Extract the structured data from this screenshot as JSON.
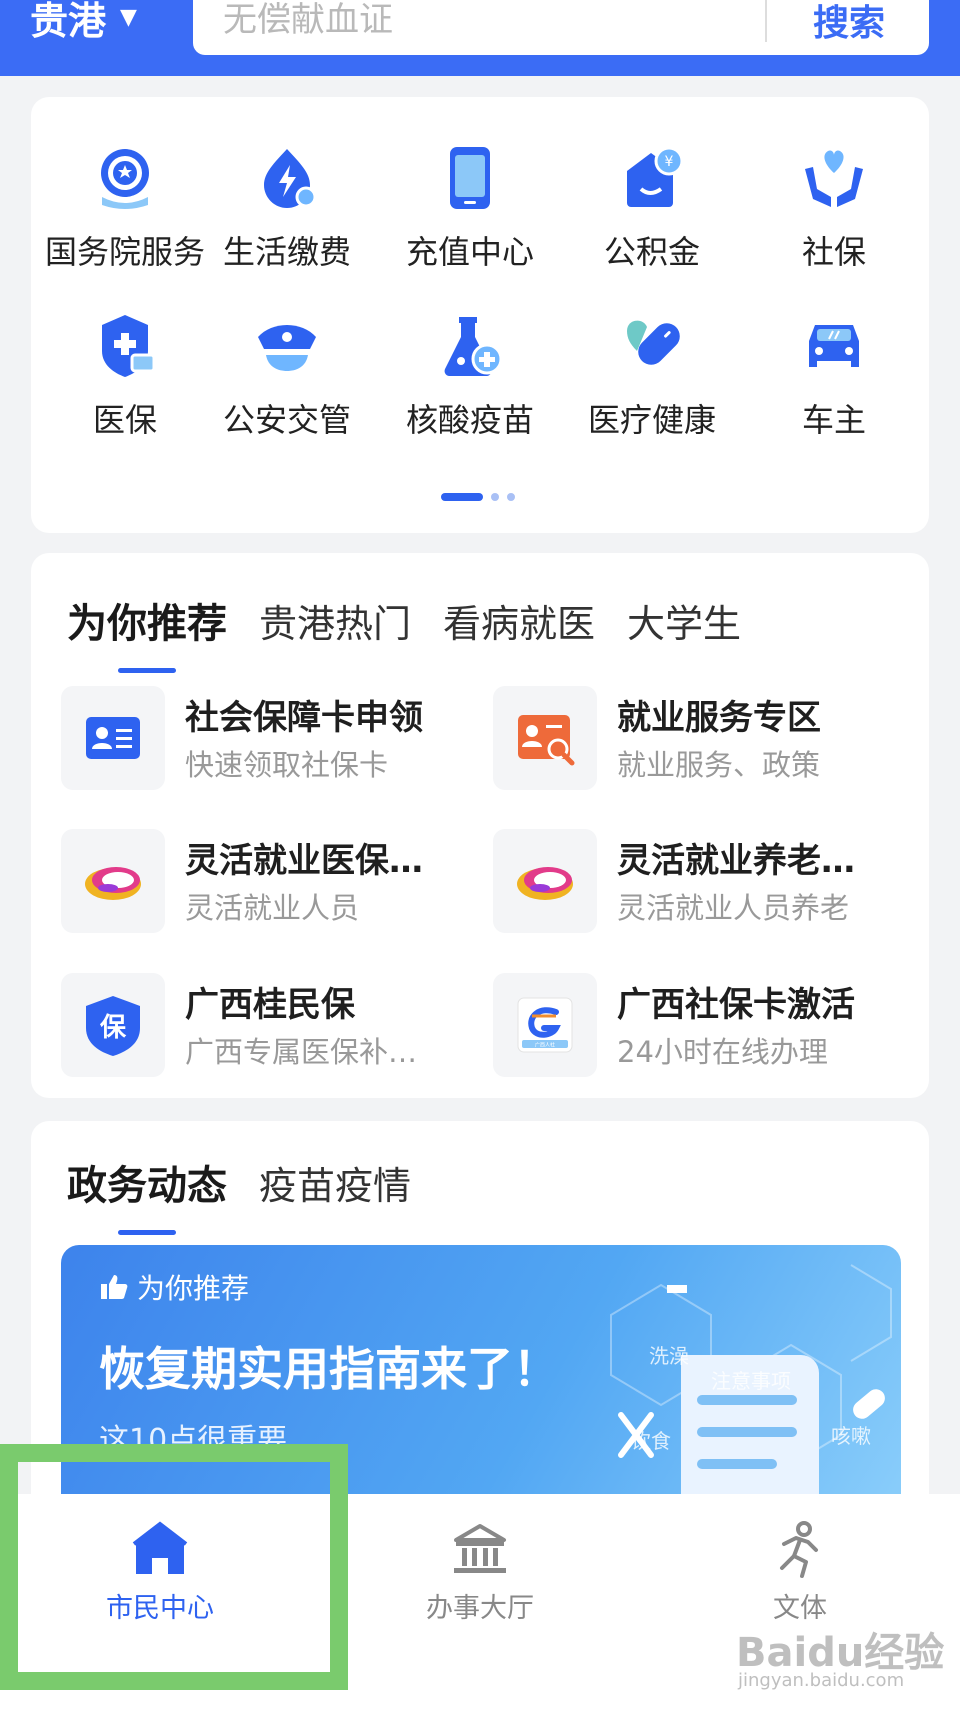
{
  "header": {
    "city": "贵港",
    "search_placeholder": "无偿献血证",
    "search_button": "搜索"
  },
  "services": [
    {
      "label": "国务院服务",
      "icon": "state-council-icon"
    },
    {
      "label": "生活缴费",
      "icon": "lightning-bill-icon"
    },
    {
      "label": "充值中心",
      "icon": "phone-recharge-icon"
    },
    {
      "label": "公积金",
      "icon": "housing-fund-icon"
    },
    {
      "label": "社保",
      "icon": "heart-hands-icon"
    },
    {
      "label": "医保",
      "icon": "medical-insurance-icon"
    },
    {
      "label": "公安交管",
      "icon": "police-cap-icon"
    },
    {
      "label": "核酸疫苗",
      "icon": "flask-icon"
    },
    {
      "label": "医疗健康",
      "icon": "pill-heart-icon"
    },
    {
      "label": "车主",
      "icon": "car-icon"
    }
  ],
  "recommend": {
    "tabs": [
      "为你推荐",
      "贵港热门",
      "看病就医",
      "大学生"
    ],
    "items": [
      {
        "title": "社会保障卡申领",
        "sub": "快速领取社保卡",
        "icon": "id-card-icon"
      },
      {
        "title": "就业服务专区",
        "sub": "就业服务、政策",
        "icon": "job-search-icon"
      },
      {
        "title": "灵活就业医保…",
        "sub": "灵活就业人员",
        "icon": "cloud-logo-icon"
      },
      {
        "title": "灵活就业养老…",
        "sub": "灵活就业人员养老",
        "icon": "cloud-logo-icon"
      },
      {
        "title": "广西桂民保",
        "sub": "广西专属医保补…",
        "icon": "shield-bao-icon"
      },
      {
        "title": "广西社保卡激活",
        "sub": "24小时在线办理",
        "icon": "guangxi-hr-icon"
      }
    ],
    "bao_char": "保",
    "guangxi_logo_text": "广西人社"
  },
  "news": {
    "tabs": [
      "政务动态",
      "疫苗疫情"
    ],
    "banner": {
      "tag": "为你推荐",
      "headline": "恢复期实用指南来了！",
      "subhead": "这10点很重要",
      "deco_labels": [
        "洗澡",
        "注意事项",
        "饮食",
        "咳嗽"
      ]
    }
  },
  "nav": [
    {
      "label": "市民中心",
      "icon": "home-icon",
      "active": true
    },
    {
      "label": "办事大厅",
      "icon": "hall-icon",
      "active": false
    },
    {
      "label": "文体",
      "icon": "running-icon",
      "active": false
    }
  ],
  "watermark": {
    "main": "Baidu经验",
    "sub": "jingyan.baidu.com"
  },
  "colors": {
    "brand": "#3b6cf5",
    "accent": "#2e62f0",
    "highlight": "#7acb6d"
  }
}
